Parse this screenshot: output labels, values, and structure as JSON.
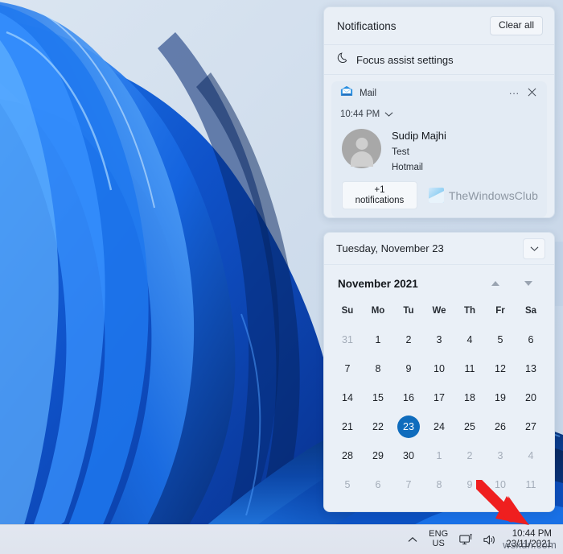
{
  "desktop": {
    "wallpaper_name": "windows-11-bloom-wallpaper",
    "wallpaper_colors": {
      "sky": "#cdd9e8",
      "deep_blue": "#0b3da8",
      "bright_blue": "#1f7cf2",
      "light_blue": "#58a6ff",
      "shadow_blue": "#062566"
    }
  },
  "notifications_panel": {
    "title": "Notifications",
    "clear_all_label": "Clear all",
    "focus_assist": {
      "label": "Focus assist settings",
      "icon": "moon-icon"
    },
    "cards": [
      {
        "app_name": "Mail",
        "app_icon": "mail-envelope-icon",
        "more_options_icon": "ellipsis-icon",
        "close_icon": "close-icon",
        "time": "10:44 PM",
        "expand_icon": "chevron-down-icon",
        "avatar_icon": "person-avatar-icon",
        "sender": "Sudip Majhi",
        "subject": "Test",
        "account": "Hotmail",
        "more_notifications_label": "+1 notifications"
      }
    ],
    "watermark": {
      "text": "TheWindowsClub",
      "logo_icon": "thewindowsclub-logo-icon"
    }
  },
  "calendar_panel": {
    "header_date": "Tuesday, November 23",
    "collapse_icon": "chevron-down-icon",
    "month_label": "November 2021",
    "prev_icon": "triangle-up-icon",
    "next_icon": "triangle-down-icon",
    "day_headers": [
      "Su",
      "Mo",
      "Tu",
      "We",
      "Th",
      "Fr",
      "Sa"
    ],
    "weeks": [
      [
        {
          "n": "31",
          "muted": true,
          "today": false
        },
        {
          "n": "1",
          "muted": false,
          "today": false
        },
        {
          "n": "2",
          "muted": false,
          "today": false
        },
        {
          "n": "3",
          "muted": false,
          "today": false
        },
        {
          "n": "4",
          "muted": false,
          "today": false
        },
        {
          "n": "5",
          "muted": false,
          "today": false
        },
        {
          "n": "6",
          "muted": false,
          "today": false
        }
      ],
      [
        {
          "n": "7",
          "muted": false,
          "today": false
        },
        {
          "n": "8",
          "muted": false,
          "today": false
        },
        {
          "n": "9",
          "muted": false,
          "today": false
        },
        {
          "n": "10",
          "muted": false,
          "today": false
        },
        {
          "n": "11",
          "muted": false,
          "today": false
        },
        {
          "n": "12",
          "muted": false,
          "today": false
        },
        {
          "n": "13",
          "muted": false,
          "today": false
        }
      ],
      [
        {
          "n": "14",
          "muted": false,
          "today": false
        },
        {
          "n": "15",
          "muted": false,
          "today": false
        },
        {
          "n": "16",
          "muted": false,
          "today": false
        },
        {
          "n": "17",
          "muted": false,
          "today": false
        },
        {
          "n": "18",
          "muted": false,
          "today": false
        },
        {
          "n": "19",
          "muted": false,
          "today": false
        },
        {
          "n": "20",
          "muted": false,
          "today": false
        }
      ],
      [
        {
          "n": "21",
          "muted": false,
          "today": false
        },
        {
          "n": "22",
          "muted": false,
          "today": false
        },
        {
          "n": "23",
          "muted": false,
          "today": true
        },
        {
          "n": "24",
          "muted": false,
          "today": false
        },
        {
          "n": "25",
          "muted": false,
          "today": false
        },
        {
          "n": "26",
          "muted": false,
          "today": false
        },
        {
          "n": "27",
          "muted": false,
          "today": false
        }
      ],
      [
        {
          "n": "28",
          "muted": false,
          "today": false
        },
        {
          "n": "29",
          "muted": false,
          "today": false
        },
        {
          "n": "30",
          "muted": false,
          "today": false
        },
        {
          "n": "1",
          "muted": true,
          "today": false
        },
        {
          "n": "2",
          "muted": true,
          "today": false
        },
        {
          "n": "3",
          "muted": true,
          "today": false
        },
        {
          "n": "4",
          "muted": true,
          "today": false
        }
      ],
      [
        {
          "n": "5",
          "muted": true,
          "today": false
        },
        {
          "n": "6",
          "muted": true,
          "today": false
        },
        {
          "n": "7",
          "muted": true,
          "today": false
        },
        {
          "n": "8",
          "muted": true,
          "today": false
        },
        {
          "n": "9",
          "muted": true,
          "today": false
        },
        {
          "n": "10",
          "muted": true,
          "today": false
        },
        {
          "n": "11",
          "muted": true,
          "today": false
        }
      ]
    ],
    "today_highlight_color": "#0f6cbd"
  },
  "taskbar": {
    "show_hidden_icons_icon": "chevron-up-icon",
    "language": {
      "line1": "ENG",
      "line2": "US"
    },
    "network_icon": "network-monitor-icon",
    "volume_icon": "speaker-icon",
    "clock": {
      "time": "10:44 PM",
      "date": "23/11/2021"
    }
  },
  "annotations": {
    "arrow_icon": "red-arrow-icon",
    "arrow_color": "#ef1f1f"
  },
  "page_watermark": {
    "text": "wsxdn.com"
  }
}
